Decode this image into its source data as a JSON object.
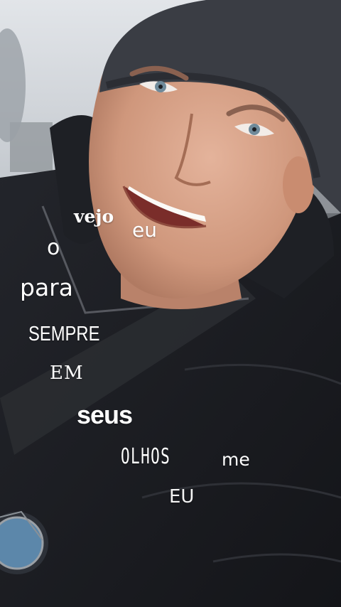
{
  "scene": {
    "description_icon": "selfie-photo"
  },
  "lyrics": {
    "word_vejo": "vejo",
    "word_eu": "eu",
    "word_o": "o",
    "word_para": "para",
    "word_sempre": "SEMPRE",
    "word_em": "EM",
    "word_seus": "seus",
    "word_olhos": "OLHOS",
    "word_me": "me",
    "word_EU": "EU"
  },
  "colors": {
    "text": "#ffffff",
    "jacket": "#1b1d22",
    "beanie": "#3a3d44",
    "skin": "#d9a58c",
    "sky": "#d9dde2"
  }
}
